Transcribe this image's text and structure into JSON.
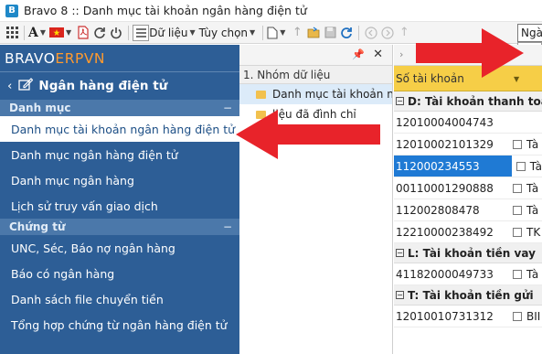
{
  "window": {
    "title": "Bravo 8 :: Danh mục tài khoản ngân hàng điện tử",
    "logo_letter": "B"
  },
  "toolbar": {
    "data_menu": "Dữ liệu",
    "options_menu": "Tùy chọn",
    "date_field": "Ngà"
  },
  "sidebar": {
    "brand_left": "BRAVO ",
    "brand_right": "ERPVN",
    "section_title": "Ngân hàng điện tử",
    "groups": [
      {
        "label": "Danh mục"
      },
      {
        "label": "Chứng từ"
      }
    ],
    "catalog_items": [
      "Danh mục tài khoản ngân hàng điện tử",
      "Danh mục ngân hàng điện tử",
      "Danh mục ngân hàng",
      "Lịch sử truy vấn giao dịch"
    ],
    "voucher_items": [
      "UNC, Séc, Báo nợ ngân hàng",
      "Báo có ngân hàng",
      "Danh sách file chuyển tiền",
      "Tổng hợp chứng từ ngân hàng điện tử"
    ]
  },
  "data_groups": {
    "header": "1. Nhóm dữ liệu",
    "rows": [
      "Danh mục tài khoản ngâ",
      "liệu đã đình chỉ"
    ]
  },
  "grid": {
    "column_header": "Số tài khoản",
    "groups": [
      {
        "label": "D: Tài khoản thanh toán",
        "rows": [
          {
            "acct": "12010004004743",
            "name": ""
          },
          {
            "acct": "12010002101329",
            "name": "Tà"
          },
          {
            "acct": "112000234553",
            "name": "Tà"
          },
          {
            "acct": "00110001290888",
            "name": "Tà"
          },
          {
            "acct": "112002808478",
            "name": "Tà"
          },
          {
            "acct": "12210000238492",
            "name": "TK"
          }
        ]
      },
      {
        "label": "L: Tài khoản tiền vay",
        "rows": [
          {
            "acct": "41182000049733",
            "name": "Tà"
          }
        ]
      },
      {
        "label": "T: Tài khoản tiền gửi",
        "rows": [
          {
            "acct": "12010010731312",
            "name": "BII"
          }
        ]
      }
    ]
  },
  "colors": {
    "sidebar_bg": "#2d5e96",
    "accent_orange": "#ff9a2e",
    "column_header_bg": "#f6ce47",
    "selected_row": "#1f7ad4",
    "arrow_red": "#e8232a"
  }
}
